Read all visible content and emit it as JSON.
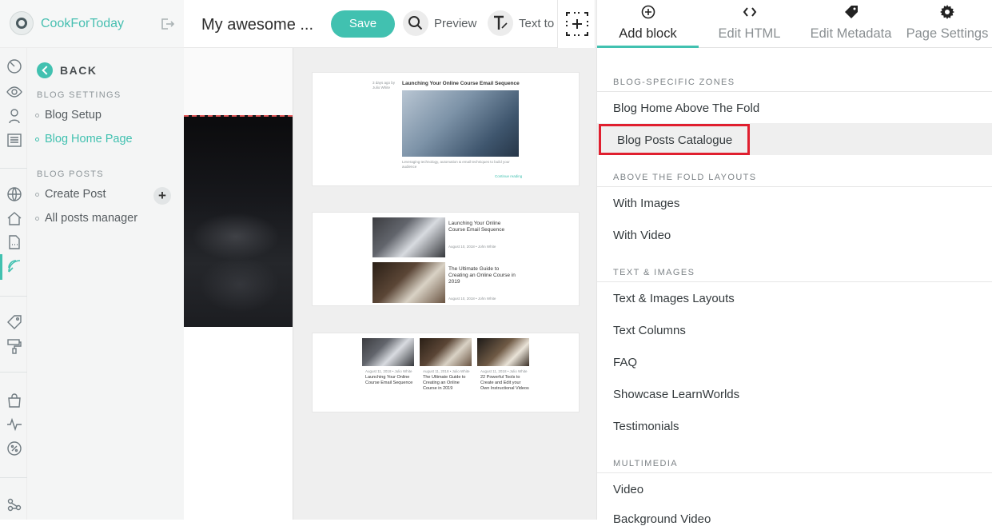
{
  "brand": {
    "name": "CookForToday"
  },
  "sidebar": {
    "back_label": "BACK",
    "sections": [
      {
        "heading": "BLOG SETTINGS",
        "items": [
          {
            "label": "Blog Setup"
          },
          {
            "label": "Blog Home Page"
          }
        ]
      },
      {
        "heading": "BLOG POSTS",
        "items": [
          {
            "label": "Create Post"
          },
          {
            "label": "All posts manager"
          }
        ]
      }
    ],
    "active_item": "Blog Home Page"
  },
  "toolbar": {
    "page_title": "My awesome ...",
    "save_label": "Save",
    "preview_label": "Preview",
    "text_tool_label": "Text to"
  },
  "panel": {
    "tabs": [
      {
        "label": "Add block",
        "icon": "plus-circle-icon",
        "active": true
      },
      {
        "label": "Edit HTML",
        "icon": "code-icon"
      },
      {
        "label": "Edit Metadata",
        "icon": "tag-icon"
      },
      {
        "label": "Page Settings",
        "icon": "gear-icon"
      }
    ],
    "sections": [
      {
        "heading": "BLOG-SPECIFIC ZONES",
        "items": [
          "Blog Home Above The Fold",
          "Blog Posts Catalogue"
        ]
      },
      {
        "heading": "ABOVE THE FOLD LAYOUTS",
        "items": [
          "With Images",
          "With Video"
        ]
      },
      {
        "heading": "TEXT & IMAGES",
        "items": [
          "Text & Images Layouts",
          "Text Columns",
          "FAQ",
          "Showcase LearnWorlds",
          "Testimonials"
        ]
      },
      {
        "heading": "MULTIMEDIA",
        "items": [
          "Video",
          "Background Video"
        ]
      }
    ],
    "selected_item": "Blog Posts Catalogue"
  },
  "previews": {
    "p1": {
      "title": "Launching Your Online Course Email Sequence",
      "meta": "3 days ago  by Julio White",
      "excerpt": "Leveraging technology, automation & email techniques to build your audience",
      "link": "Continue reading"
    },
    "p2": {
      "posts": [
        {
          "title": "Launching Your Online Course Email Sequence",
          "meta": "August 10, 2018  •  John White"
        },
        {
          "title": "The Ultimate Guide to Creating an Online Course in 2019",
          "meta": "August 10, 2018  •  John White"
        }
      ]
    },
    "p3": {
      "posts": [
        {
          "title": "Launching Your Online Course Email Sequence",
          "meta": "August 11, 2018  •  Julio White"
        },
        {
          "title": "The Ultimate Guide to Creating an Online Course in 2019",
          "meta": "August 11, 2018  •  Julio White"
        },
        {
          "title": "22 Powerful Tools to Create and Edit your Own Instructional Videos",
          "meta": "August 11, 2018  •  Julio White"
        }
      ]
    }
  },
  "colors": {
    "accent": "#41c1b0",
    "highlight": "#e01f2f"
  }
}
